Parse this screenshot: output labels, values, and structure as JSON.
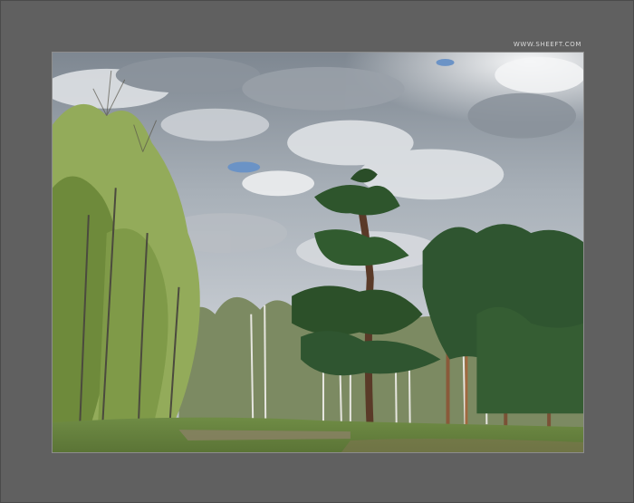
{
  "watermark": {
    "text": "WWW.SHEEFT.COM"
  },
  "photo": {
    "subject": "",
    "colors": {
      "frame": "#606060",
      "sky_light": "#dfe3e7",
      "sky_cloud": "#7f8892",
      "sky_blue": "#5f8fc9",
      "grass": "#6a8a3e",
      "pine": "#2f5530",
      "birch_leaves": "#8fae4f"
    }
  }
}
